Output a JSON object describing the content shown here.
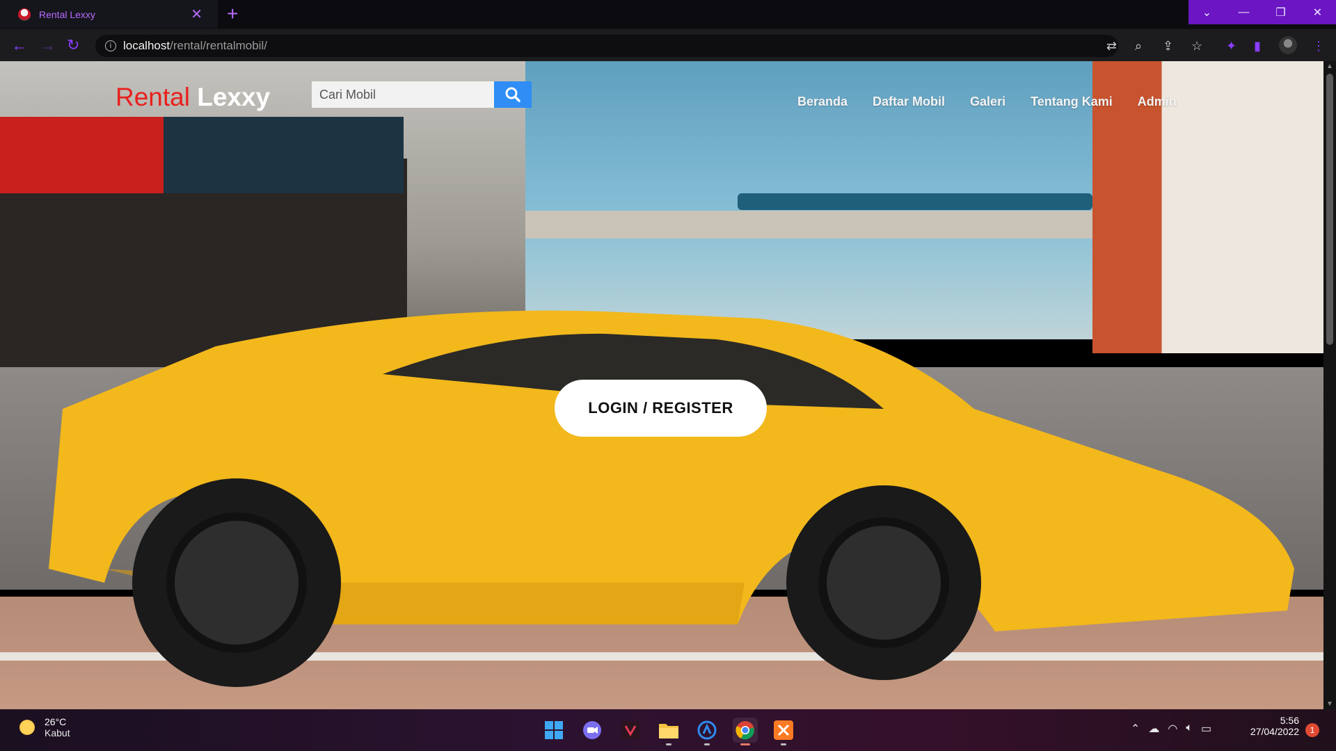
{
  "browser": {
    "tab_title": "Rental Lexxy",
    "tab_close": "✕",
    "new_tab": "+",
    "url_host": "localhost",
    "url_path": "/rental/rentalmobil/"
  },
  "page": {
    "logo_part1": "Rental",
    "logo_part2": "Lexxy",
    "search_placeholder": "Cari Mobil",
    "menu": [
      "Beranda",
      "Daftar Mobil",
      "Galeri",
      "Tentang Kami",
      "Admin"
    ],
    "cta_label": "LOGIN / REGISTER"
  },
  "taskbar": {
    "weather_temp": "26°C",
    "weather_condition": "Kabut",
    "time": "5:56",
    "date": "27/04/2022",
    "notification_count": "1"
  },
  "colors": {
    "accent": "#8b3dff",
    "logo_red": "#e8201d",
    "search_button": "#2f8df5",
    "car_yellow": "#f2b81c"
  }
}
